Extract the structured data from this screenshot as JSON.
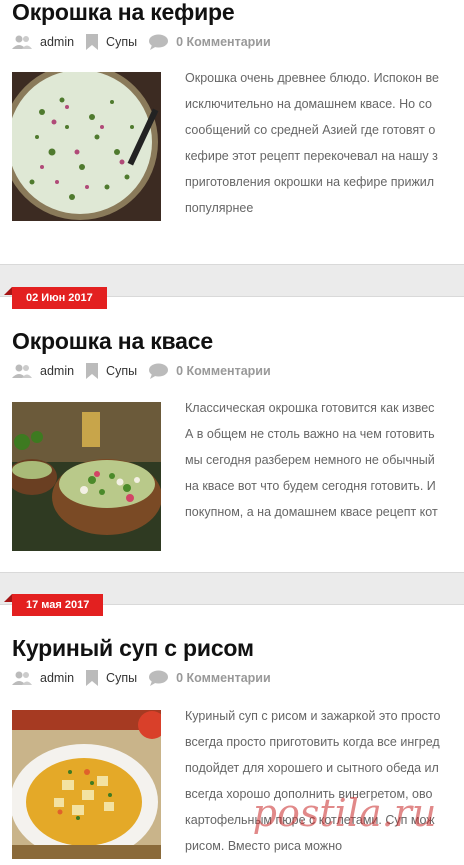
{
  "posts": [
    {
      "date": "",
      "title": "Окрошка на кефире",
      "author": "admin",
      "category": "Супы",
      "comments": "0 Комментарии",
      "excerpt": [
        "Окрошка очень древнее блюдо. Испокон ве",
        "исключительно на домашнем квасе. Но со",
        "сообщений со средней Азией где готовят о",
        "кефире этот рецепт перекочевал на нашу з",
        "приготовления окрошки на кефире прижил",
        "популярнее"
      ]
    },
    {
      "date": "02 Июн 2017",
      "title": "Окрошка на квасе",
      "author": "admin",
      "category": "Супы",
      "comments": "0 Комментарии",
      "excerpt": [
        "Классическая окрошка готовится как извес",
        "А в общем не столь важно на чем готовить",
        "мы сегодня разберем немного не обычный",
        "на квасе вот что будем сегодня готовить. И",
        "покупном, а на домашнем квасе рецепт кот"
      ]
    },
    {
      "date": "17 мая 2017",
      "title": "Куриный суп с рисом",
      "author": "admin",
      "category": "Супы",
      "comments": "0 Комментарии",
      "excerpt": [
        "Куриный суп с рисом и зажаркой это просто",
        "всегда просто приготовить когда все ингред",
        "подойдет для хорошего и сытного обеда ил",
        "всегда хорошо дополнить винегретом,  ово",
        " картофельным пюре с котлетами. Суп мож",
        "рисом. Вместо риса можно"
      ]
    }
  ],
  "watermark": "postila.ru",
  "icons": {
    "author": "user-icon",
    "category": "bookmark-icon",
    "comments": "comment-icon"
  },
  "colors": {
    "accent": "#e32020",
    "separator": "#ebebeb"
  }
}
